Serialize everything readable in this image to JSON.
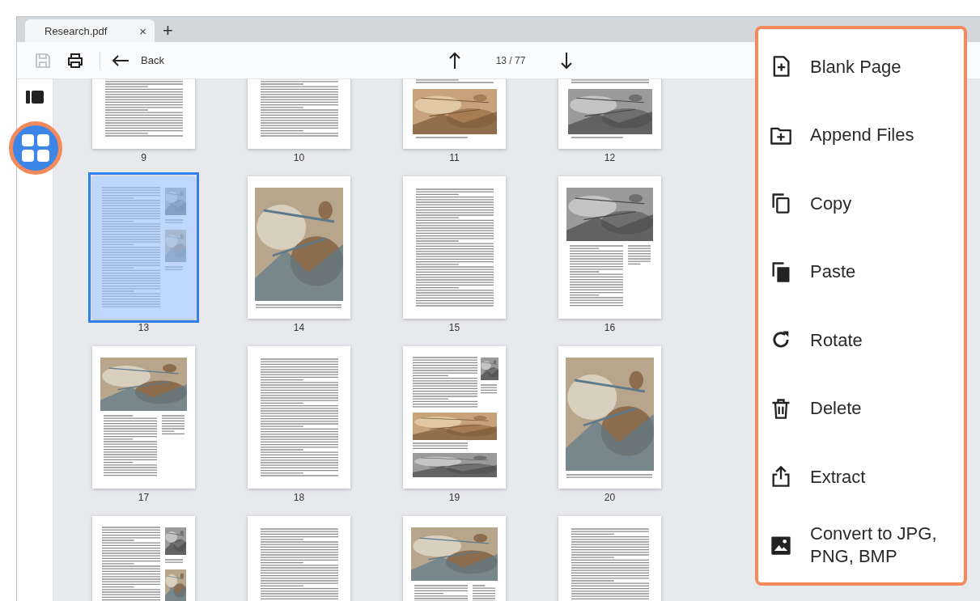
{
  "tab": {
    "title": "Research.pdf",
    "close": "×",
    "new_tab": "+"
  },
  "toolbar": {
    "save_disabled": true,
    "back": "Back",
    "page_indicator": "13 / 77"
  },
  "sidebar": {
    "buttons": [
      {
        "kind": "panel",
        "selected": false
      },
      {
        "kind": "grid",
        "selected": true
      }
    ]
  },
  "pages": [
    {
      "label": "9",
      "selected": false,
      "kind": "text"
    },
    {
      "label": "10",
      "selected": false,
      "kind": "text"
    },
    {
      "label": "11",
      "selected": false,
      "kind": "photo-bottom"
    },
    {
      "label": "12",
      "selected": false,
      "kind": "photo-bottom"
    },
    {
      "label": "13",
      "selected": true,
      "kind": "side"
    },
    {
      "label": "14",
      "selected": false,
      "kind": "photo-full"
    },
    {
      "label": "15",
      "selected": false,
      "kind": "text"
    },
    {
      "label": "16",
      "selected": false,
      "kind": "photo-top"
    },
    {
      "label": "17",
      "selected": false,
      "kind": "photo-top"
    },
    {
      "label": "18",
      "selected": false,
      "kind": "text"
    },
    {
      "label": "19",
      "selected": false,
      "kind": "mixed"
    },
    {
      "label": "20",
      "selected": false,
      "kind": "photo-full"
    },
    {
      "selected": false,
      "kind": "side"
    },
    {
      "selected": false,
      "kind": "text"
    },
    {
      "selected": false,
      "kind": "photo-top"
    },
    {
      "selected": false,
      "kind": "text"
    }
  ],
  "menu": {
    "items": [
      {
        "label": "Blank Page"
      },
      {
        "label": "Append Files"
      },
      {
        "label": "Copy"
      },
      {
        "label": "Paste"
      },
      {
        "label": "Rotate"
      },
      {
        "label": "Delete"
      },
      {
        "label": "Extract"
      },
      {
        "label": "Convert to JPG, PNG, BMP"
      }
    ]
  }
}
